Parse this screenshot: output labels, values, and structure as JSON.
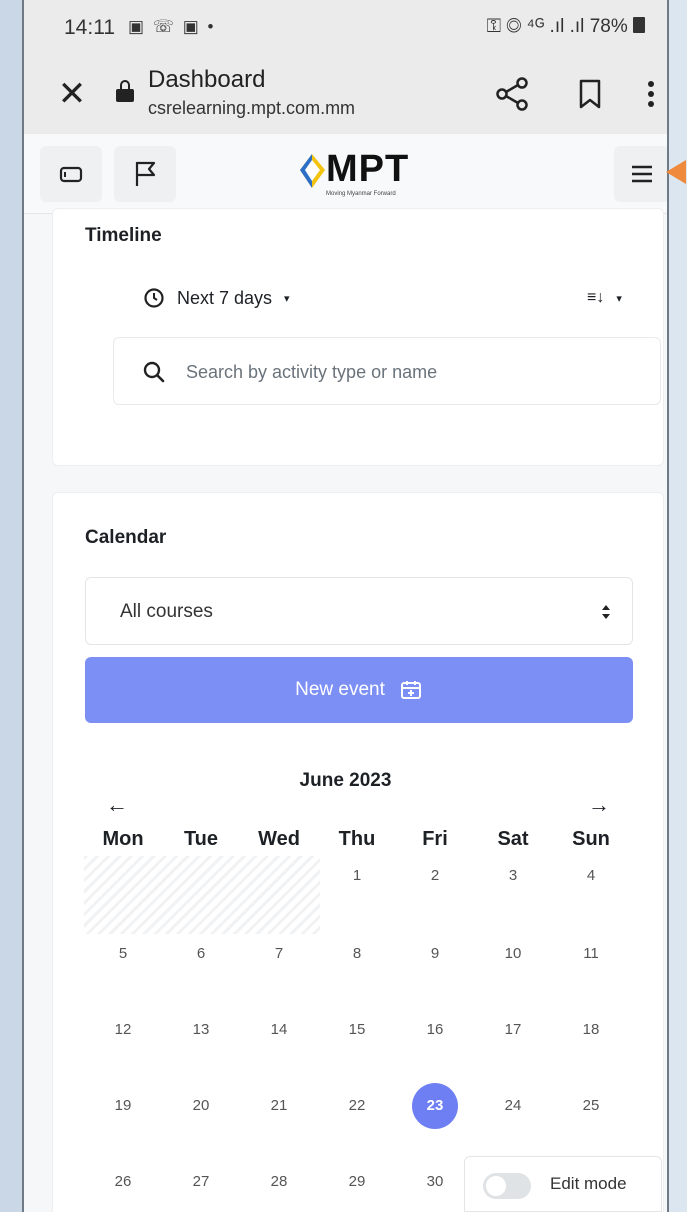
{
  "status_bar": {
    "time": "14:11",
    "notifications": "▣ ☏ ▣ •",
    "indicators": "⚿ ◎ ⁴ᴳ .ıl .ıl",
    "battery": "78%"
  },
  "browser": {
    "title": "Dashboard",
    "url": "csrelearning.mpt.com.mm"
  },
  "site": {
    "logo_text": "MPT",
    "logo_tagline": "Moving Myanmar Forward"
  },
  "timeline": {
    "title": "Timeline",
    "filter_label": "Next 7 days",
    "sort_label": "≡↓",
    "search_placeholder": "Search by activity type or name"
  },
  "calendar": {
    "title": "Calendar",
    "course_filter": "All courses",
    "new_event_label": "New event",
    "month": "June 2023",
    "prev_arrow": "←",
    "next_arrow": "→",
    "weekdays": [
      "Mon",
      "Tue",
      "Wed",
      "Thu",
      "Fri",
      "Sat",
      "Sun"
    ],
    "weeks": [
      [
        "",
        "",
        "",
        "1",
        "2",
        "3",
        "4"
      ],
      [
        "5",
        "6",
        "7",
        "8",
        "9",
        "10",
        "11"
      ],
      [
        "12",
        "13",
        "14",
        "15",
        "16",
        "17",
        "18"
      ],
      [
        "19",
        "20",
        "21",
        "22",
        "23",
        "24",
        "25"
      ],
      [
        "26",
        "27",
        "28",
        "29",
        "30",
        "",
        ""
      ]
    ],
    "today": "23",
    "accent_color": "#7c8ff5"
  },
  "edit_mode": {
    "label": "Edit mode",
    "enabled": false
  }
}
